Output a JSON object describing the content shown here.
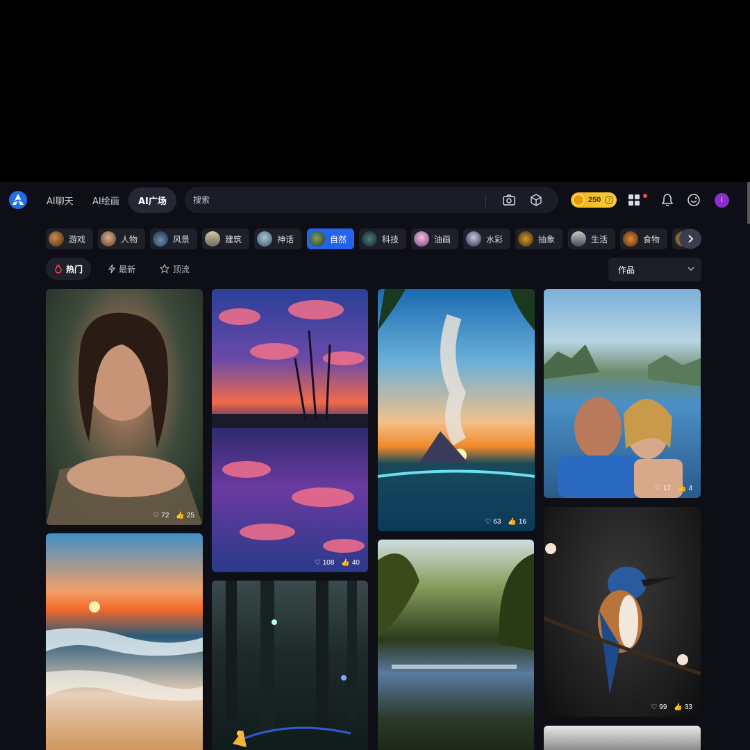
{
  "nav": {
    "tabs": [
      {
        "label": "AI聊天"
      },
      {
        "label": "AI绘画"
      },
      {
        "label": "AI广场"
      }
    ],
    "active_tab": "AI广场"
  },
  "search": {
    "placeholder": "搜索",
    "value": ""
  },
  "coins": {
    "value": "250",
    "help": "?"
  },
  "user": {
    "avatar_letter": "i"
  },
  "categories": [
    {
      "label": "游戏"
    },
    {
      "label": "人物"
    },
    {
      "label": "风景"
    },
    {
      "label": "建筑"
    },
    {
      "label": "神话"
    },
    {
      "label": "自然"
    },
    {
      "label": "科技"
    },
    {
      "label": "油画"
    },
    {
      "label": "水彩"
    },
    {
      "label": "抽象"
    },
    {
      "label": "生活"
    },
    {
      "label": "食物"
    }
  ],
  "active_category": "自然",
  "sort": {
    "tabs": [
      {
        "label": "热门"
      },
      {
        "label": "最新"
      },
      {
        "label": "顶流"
      }
    ],
    "active": "热门",
    "filter_selected": "作品"
  },
  "gallery": [
    {
      "subject": "woman-in-water",
      "likes": "72",
      "thumbs": "25"
    },
    {
      "subject": "sunset-beach-waves",
      "likes": "",
      "thumbs": ""
    },
    {
      "subject": "red-clouds-lake-reflection",
      "likes": "108",
      "thumbs": "40"
    },
    {
      "subject": "glowing-forest-butterflies",
      "likes": "",
      "thumbs": ""
    },
    {
      "subject": "tropical-volcano-underwater",
      "likes": "63",
      "thumbs": "16"
    },
    {
      "subject": "forest-lake-sunrise",
      "likes": "",
      "thumbs": ""
    },
    {
      "subject": "couple-selfie-rio",
      "likes": "17",
      "thumbs": "4"
    },
    {
      "subject": "kingfisher-on-branch",
      "likes": "99",
      "thumbs": "33"
    }
  ],
  "colors": {
    "accent": "#2563eb",
    "background": "#0e0f16",
    "coin": "#f3b21a"
  }
}
